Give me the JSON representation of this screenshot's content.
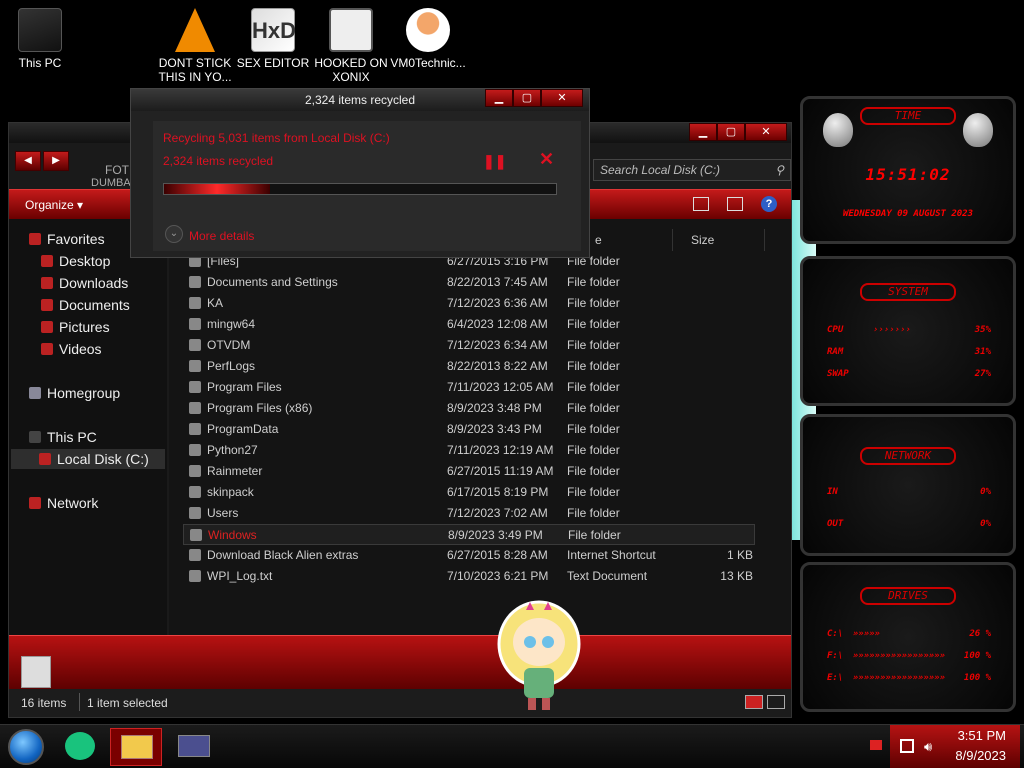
{
  "desktop_icons": [
    {
      "label": "This PC",
      "icon": "computer-icon"
    },
    {
      "label": "DONT STICK THIS IN YO...",
      "icon": "vlc-cone-icon"
    },
    {
      "label": "SEX EDITOR",
      "icon": "hxd-icon"
    },
    {
      "label": "HOOKED ON XONIX",
      "icon": "game-icon"
    },
    {
      "label": "VM0Technic...",
      "icon": "doctor-avatar-icon"
    }
  ],
  "dialog": {
    "title": "2,324 items recycled",
    "line1": "Recycling 5,031 items from Local Disk (C:)",
    "line2": "2,324 items recycled",
    "progress": 0.27,
    "more_details": "More details",
    "pause_glyph": "❚❚",
    "close_glyph": "✕"
  },
  "explorer": {
    "behind_text_1": "FOT",
    "behind_text_2": "DUMBA",
    "search_placeholder": "Search Local Disk (C:)",
    "organize": "Organize ▾",
    "nav": {
      "favorites": "Favorites",
      "desktop": "Desktop",
      "downloads": "Downloads",
      "documents": "Documents",
      "pictures": "Pictures",
      "videos": "Videos",
      "homegroup": "Homegroup",
      "this_pc": "This PC",
      "local_disk": "Local Disk (C:)",
      "network": "Network"
    },
    "columns": {
      "type_partial": "e",
      "size": "Size"
    },
    "rows": [
      {
        "name": "[Files]",
        "date": "6/27/2015 3:16 PM",
        "type": "File folder",
        "size": ""
      },
      {
        "name": "Documents and Settings",
        "date": "8/22/2013 7:45 AM",
        "type": "File folder",
        "size": ""
      },
      {
        "name": "KA",
        "date": "7/12/2023 6:36 AM",
        "type": "File folder",
        "size": ""
      },
      {
        "name": "mingw64",
        "date": "6/4/2023 12:08 AM",
        "type": "File folder",
        "size": ""
      },
      {
        "name": "OTVDM",
        "date": "7/12/2023 6:34 AM",
        "type": "File folder",
        "size": ""
      },
      {
        "name": "PerfLogs",
        "date": "8/22/2013 8:22 AM",
        "type": "File folder",
        "size": ""
      },
      {
        "name": "Program Files",
        "date": "7/11/2023 12:05 AM",
        "type": "File folder",
        "size": ""
      },
      {
        "name": "Program Files (x86)",
        "date": "8/9/2023 3:48 PM",
        "type": "File folder",
        "size": ""
      },
      {
        "name": "ProgramData",
        "date": "8/9/2023 3:43 PM",
        "type": "File folder",
        "size": ""
      },
      {
        "name": "Python27",
        "date": "7/11/2023 12:19 AM",
        "type": "File folder",
        "size": ""
      },
      {
        "name": "Rainmeter",
        "date": "6/27/2015 11:19 AM",
        "type": "File folder",
        "size": ""
      },
      {
        "name": "skinpack",
        "date": "6/17/2015 8:19 PM",
        "type": "File folder",
        "size": ""
      },
      {
        "name": "Users",
        "date": "7/12/2023 7:02 AM",
        "type": "File folder",
        "size": ""
      },
      {
        "name": "Windows",
        "date": "8/9/2023 3:49 PM",
        "type": "File folder",
        "size": ""
      },
      {
        "name": "Download Black Alien extras",
        "date": "6/27/2015 8:28 AM",
        "type": "Internet Shortcut",
        "size": "1 KB"
      },
      {
        "name": "WPI_Log.txt",
        "date": "7/10/2023 6:21 PM",
        "type": "Text Document",
        "size": "13 KB"
      }
    ],
    "status_items": "16 items",
    "status_selected": "1 item selected"
  },
  "gadgets": {
    "time": {
      "title": "TIME",
      "clock": "15:51:02",
      "date": "WEDNESDAY 09 AUGUST 2023"
    },
    "system": {
      "title": "SYSTEM",
      "cpu_label": "CPU",
      "cpu_bar": "›››››››",
      "cpu_val": "35%",
      "ram_label": "RAM",
      "ram_val": "31%",
      "swap_label": "SWAP",
      "swap_val": "27%"
    },
    "network": {
      "title": "NETWORK",
      "in_label": "IN",
      "in_val": "0%",
      "out_label": "OUT",
      "out_val": "0%"
    },
    "drives": {
      "title": "DRIVES",
      "c_label": "C:\\",
      "c_bar": "»»»»»",
      "c_val": "26 %",
      "f_label": "F:\\",
      "f_bar": "»»»»»»»»»»»»»»»»»",
      "f_val": "100 %",
      "e_label": "E:\\",
      "e_bar": "»»»»»»»»»»»»»»»»»",
      "e_val": "100 %"
    }
  },
  "taskbar": {
    "time": "3:51 PM",
    "date": "8/9/2023"
  },
  "colors": {
    "accent": "#c41a1a",
    "accent_dark": "#5e0000",
    "text_red": "#d11a22"
  }
}
